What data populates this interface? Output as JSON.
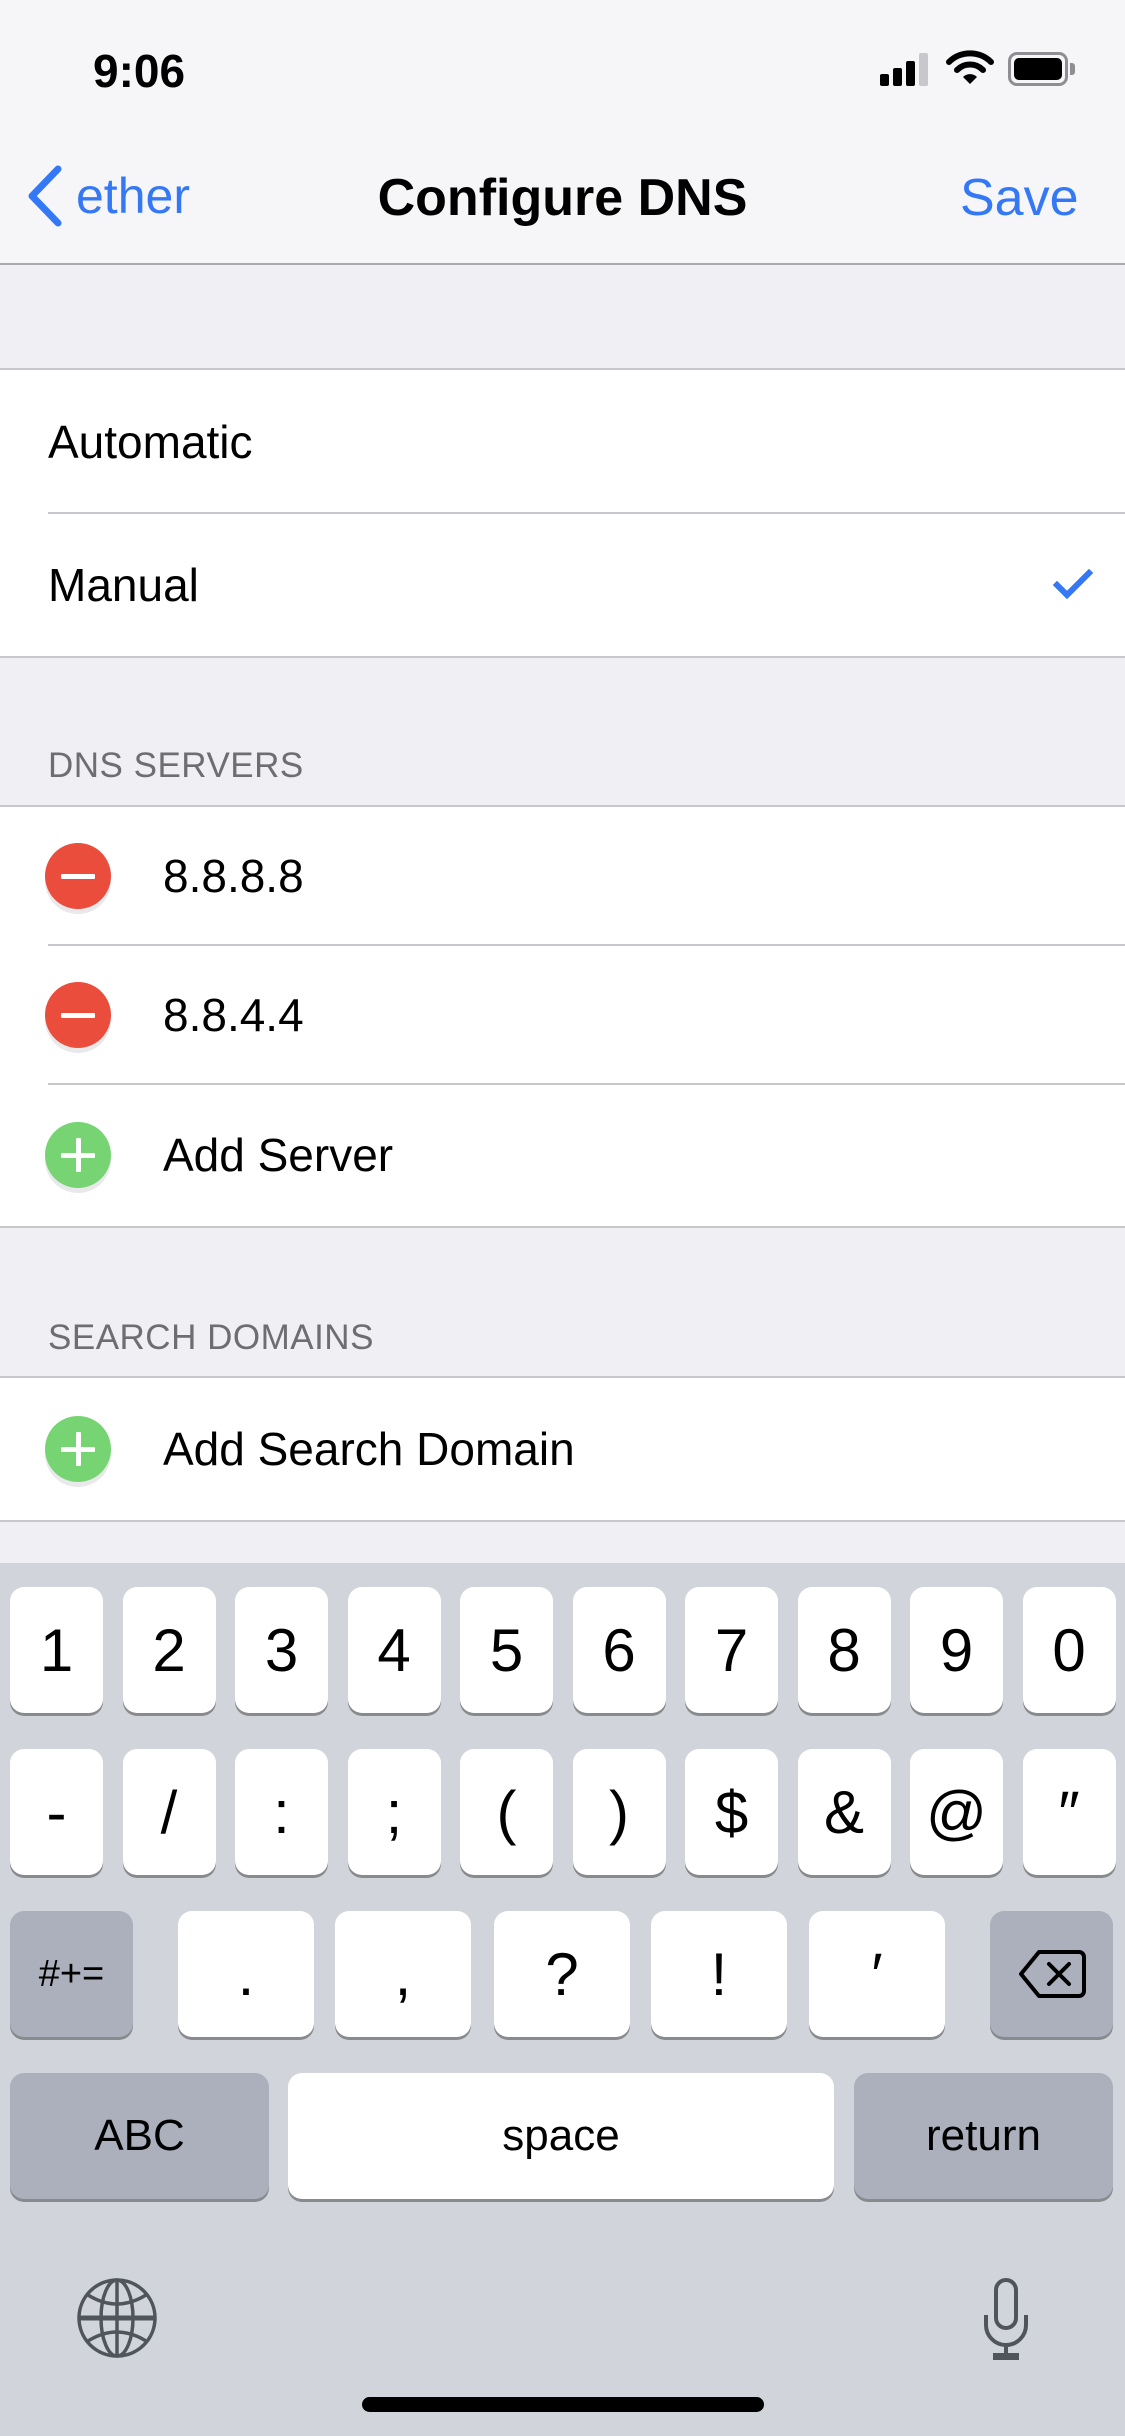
{
  "status_bar": {
    "time": "9:06",
    "signal_bars_active": 3,
    "signal_bars_total": 4,
    "wifi_icon": "wifi-icon",
    "battery_icon": "battery-full-icon"
  },
  "nav": {
    "back_label": "ether",
    "back_icon": "chevron-left-icon",
    "title": "Configure DNS",
    "save_label": "Save"
  },
  "mode": {
    "options": [
      {
        "label": "Automatic",
        "selected": false
      },
      {
        "label": "Manual",
        "selected": true
      }
    ],
    "check_icon": "checkmark-icon"
  },
  "dns_servers": {
    "header": "DNS SERVERS",
    "servers": [
      "8.8.8.8",
      "8.8.4.4"
    ],
    "add_label": "Add Server",
    "remove_icon": "minus-circle-icon",
    "add_icon": "plus-circle-icon"
  },
  "search_domains": {
    "header": "SEARCH DOMAINS",
    "add_label": "Add Search Domain"
  },
  "keyboard": {
    "row1": [
      "1",
      "2",
      "3",
      "4",
      "5",
      "6",
      "7",
      "8",
      "9",
      "0"
    ],
    "row2": [
      "-",
      "/",
      ":",
      ";",
      "(",
      ")",
      "$",
      "&",
      "@",
      "″"
    ],
    "row3_left": "#+=",
    "row3_mid": [
      ".",
      ",",
      "?",
      "!",
      "′"
    ],
    "row3_right_icon": "delete-backspace-icon",
    "row4": {
      "abc": "ABC",
      "space": "space",
      "return": "return"
    },
    "globe_icon": "globe-icon",
    "mic_icon": "microphone-icon"
  },
  "colors": {
    "accent": "#3478F6",
    "destructive": "#EB4D3D",
    "add": "#76D572",
    "grouped_background": "#EFEFF4",
    "keyboard_background": "#D1D5DB"
  }
}
